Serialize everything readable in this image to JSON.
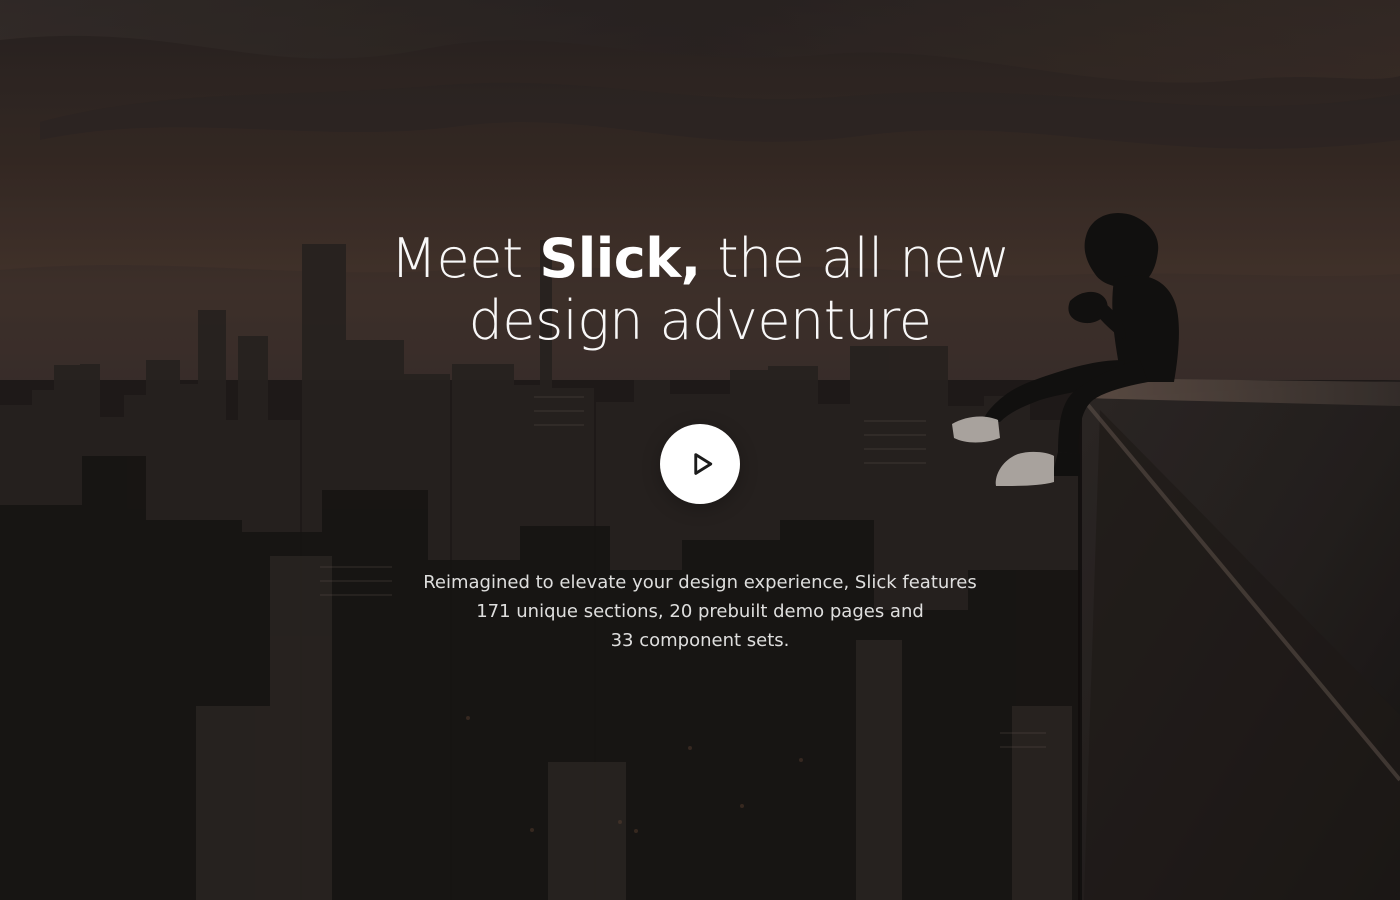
{
  "hero": {
    "headline": {
      "line1_prefix": "Meet ",
      "line1_brand": "Slick,",
      "line1_suffix": " the all new",
      "line2": "design adventure"
    },
    "play_button": {
      "icon": "play-icon"
    },
    "description": {
      "line1": "Reimagined to elevate your design experience, Slick features",
      "line2": "171 unique sections, 20 prebuilt demo pages and",
      "line3": "33 component sets."
    }
  },
  "colors": {
    "overlay": "#14100e",
    "text": "#ffffff",
    "button": "#ffffff",
    "icon": "#1b1b1b"
  }
}
